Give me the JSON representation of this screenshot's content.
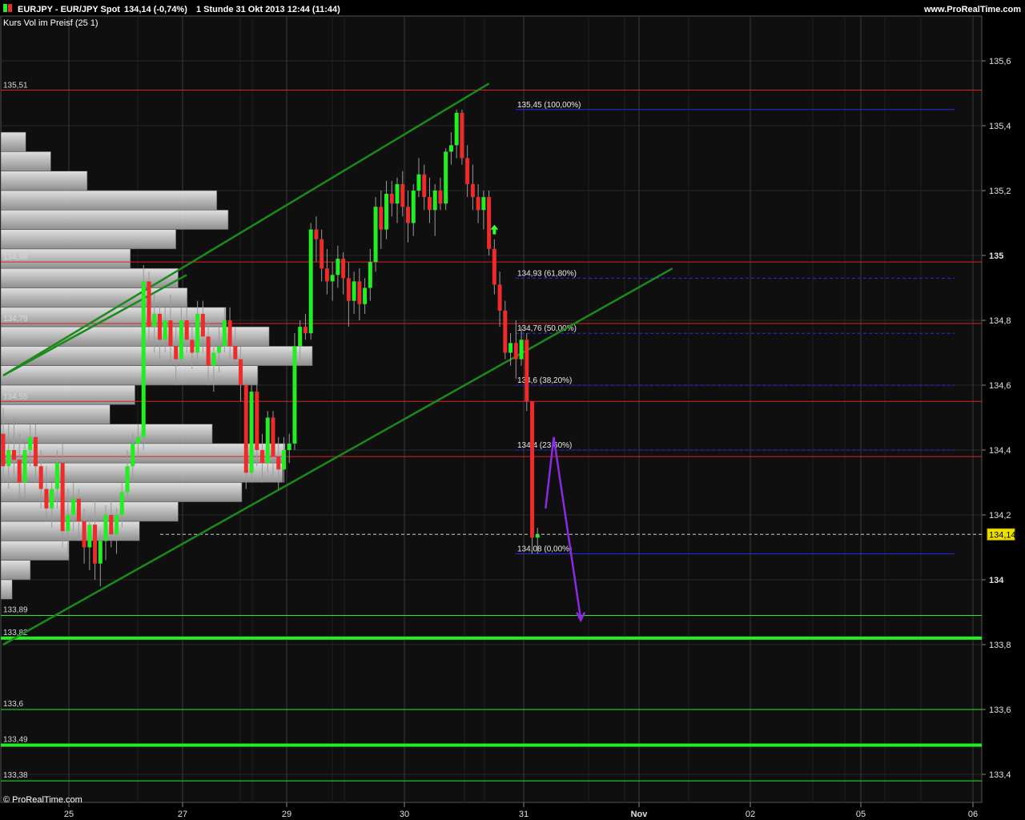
{
  "header": {
    "symbol": "EURJPY - EUR/JPY Spot",
    "quote": "134,14 (-0,74%)",
    "period": "1 Stunde  31 Okt 2013 12:44 (11:44)",
    "site": "www.ProRealTime.com",
    "subtitle": "Kurs  Vol im Preisf (25 1)",
    "watermark": "© ProRealTime.com"
  },
  "colors": {
    "background": "#000000",
    "plot": "#0f0f0f",
    "bull": "#22ee22",
    "bear": "#ee2a2a",
    "channel": "#1a8a1a",
    "support": "#22ee22",
    "resistance": "#dd2222",
    "fib": "#2a2aee",
    "projection": "#8a2be2",
    "last_price_badge": "#f0e000"
  },
  "chart_data": {
    "type": "candlestick",
    "ylim": [
      133.3,
      135.65
    ],
    "y_ticks": [
      {
        "value": 135.6,
        "label": "135,6"
      },
      {
        "value": 135.4,
        "label": "135,4"
      },
      {
        "value": 135.2,
        "label": "135,2"
      },
      {
        "value": 135.0,
        "label": "135"
      },
      {
        "value": 134.8,
        "label": "134,8"
      },
      {
        "value": 134.6,
        "label": "134,6"
      },
      {
        "value": 134.4,
        "label": "134,4"
      },
      {
        "value": 134.2,
        "label": "134,2"
      },
      {
        "value": 134.0,
        "label": "134"
      },
      {
        "value": 133.8,
        "label": "133,8"
      },
      {
        "value": 133.6,
        "label": "133,6"
      },
      {
        "value": 133.4,
        "label": "133,4"
      }
    ],
    "bold_y_ticks": [
      "135",
      "134"
    ],
    "x_ticks": [
      "25",
      "27",
      "29",
      "30",
      "31",
      "Nov",
      "02",
      "05",
      "06"
    ],
    "last_price": {
      "value": 134.14,
      "label": "134,14"
    },
    "resistance_levels": [
      {
        "value": 135.51,
        "label": "135,51"
      },
      {
        "value": 134.98,
        "label": "134,98"
      },
      {
        "value": 134.79,
        "label": "134,79"
      },
      {
        "value": 134.55,
        "label": "134,55"
      },
      {
        "value": 134.38,
        "label": "134,38"
      }
    ],
    "support_levels": [
      {
        "value": 133.89,
        "label": "133,89",
        "weight": "thin"
      },
      {
        "value": 133.82,
        "label": "133,82",
        "weight": "thick"
      },
      {
        "value": 133.6,
        "label": "133,6",
        "weight": "thin"
      },
      {
        "value": 133.49,
        "label": "133,49",
        "weight": "thick"
      },
      {
        "value": 133.38,
        "label": "133,38",
        "weight": "thin"
      }
    ],
    "fibonacci": [
      {
        "value": 135.45,
        "label": "135,45 (100,00%)",
        "style": "solid"
      },
      {
        "value": 134.93,
        "label": "134,93 (61,80%)",
        "style": "dashed"
      },
      {
        "value": 134.76,
        "label": "134,76 (50,00%)",
        "style": "dashed"
      },
      {
        "value": 134.6,
        "label": "134,6 (38,20%)",
        "style": "dashed"
      },
      {
        "value": 134.4,
        "label": "134,4 (23,60%)",
        "style": "dashed"
      },
      {
        "value": 134.08,
        "label": "134,08 (0,00%)",
        "style": "solid"
      }
    ],
    "volume_profile": [
      {
        "lo": 135.32,
        "hi": 135.38,
        "rel": 0.11
      },
      {
        "lo": 135.26,
        "hi": 135.32,
        "rel": 0.22
      },
      {
        "lo": 135.2,
        "hi": 135.26,
        "rel": 0.38
      },
      {
        "lo": 135.14,
        "hi": 135.2,
        "rel": 0.95
      },
      {
        "lo": 135.08,
        "hi": 135.14,
        "rel": 1.0
      },
      {
        "lo": 135.02,
        "hi": 135.08,
        "rel": 0.77
      },
      {
        "lo": 134.96,
        "hi": 135.02,
        "rel": 0.57
      },
      {
        "lo": 134.9,
        "hi": 134.96,
        "rel": 0.78
      },
      {
        "lo": 134.84,
        "hi": 134.9,
        "rel": 0.82
      },
      {
        "lo": 134.78,
        "hi": 134.84,
        "rel": 0.99
      },
      {
        "lo": 134.72,
        "hi": 134.78,
        "rel": 1.18
      },
      {
        "lo": 134.66,
        "hi": 134.72,
        "rel": 1.37
      },
      {
        "lo": 134.6,
        "hi": 134.66,
        "rel": 1.13
      },
      {
        "lo": 134.54,
        "hi": 134.6,
        "rel": 0.59
      },
      {
        "lo": 134.48,
        "hi": 134.54,
        "rel": 0.48
      },
      {
        "lo": 134.42,
        "hi": 134.48,
        "rel": 0.93
      },
      {
        "lo": 134.36,
        "hi": 134.42,
        "rel": 1.25
      },
      {
        "lo": 134.3,
        "hi": 134.36,
        "rel": 1.24
      },
      {
        "lo": 134.24,
        "hi": 134.3,
        "rel": 1.06
      },
      {
        "lo": 134.18,
        "hi": 134.24,
        "rel": 0.78
      },
      {
        "lo": 134.12,
        "hi": 134.18,
        "rel": 0.61
      },
      {
        "lo": 134.06,
        "hi": 134.12,
        "rel": 0.3
      },
      {
        "lo": 134.0,
        "hi": 134.06,
        "rel": 0.13
      },
      {
        "lo": 133.94,
        "hi": 134.0,
        "rel": 0.05
      }
    ],
    "candles": [
      {
        "o": 134.45,
        "h": 134.53,
        "l": 134.3,
        "c": 134.35
      },
      {
        "o": 134.35,
        "h": 134.48,
        "l": 134.28,
        "c": 134.4
      },
      {
        "o": 134.4,
        "h": 134.5,
        "l": 134.32,
        "c": 134.37
      },
      {
        "o": 134.37,
        "h": 134.45,
        "l": 134.25,
        "c": 134.3
      },
      {
        "o": 134.3,
        "h": 134.42,
        "l": 134.25,
        "c": 134.4
      },
      {
        "o": 134.4,
        "h": 134.48,
        "l": 134.35,
        "c": 134.44
      },
      {
        "o": 134.44,
        "h": 134.48,
        "l": 134.3,
        "c": 134.35
      },
      {
        "o": 134.35,
        "h": 134.4,
        "l": 134.22,
        "c": 134.28
      },
      {
        "o": 134.28,
        "h": 134.35,
        "l": 134.18,
        "c": 134.22
      },
      {
        "o": 134.22,
        "h": 134.3,
        "l": 134.16,
        "c": 134.28
      },
      {
        "o": 134.28,
        "h": 134.4,
        "l": 134.22,
        "c": 134.36
      },
      {
        "o": 134.36,
        "h": 134.42,
        "l": 134.1,
        "c": 134.15
      },
      {
        "o": 134.15,
        "h": 134.28,
        "l": 134.08,
        "c": 134.2
      },
      {
        "o": 134.2,
        "h": 134.3,
        "l": 134.15,
        "c": 134.25
      },
      {
        "o": 134.25,
        "h": 134.28,
        "l": 134.12,
        "c": 134.18
      },
      {
        "o": 134.18,
        "h": 134.22,
        "l": 134.05,
        "c": 134.1
      },
      {
        "o": 134.1,
        "h": 134.2,
        "l": 134.03,
        "c": 134.17
      },
      {
        "o": 134.17,
        "h": 134.25,
        "l": 134.0,
        "c": 134.05
      },
      {
        "o": 134.05,
        "h": 134.15,
        "l": 133.98,
        "c": 134.12
      },
      {
        "o": 134.12,
        "h": 134.23,
        "l": 134.06,
        "c": 134.2
      },
      {
        "o": 134.2,
        "h": 134.26,
        "l": 134.1,
        "c": 134.14
      },
      {
        "o": 134.14,
        "h": 134.22,
        "l": 134.08,
        "c": 134.2
      },
      {
        "o": 134.2,
        "h": 134.3,
        "l": 134.16,
        "c": 134.27
      },
      {
        "o": 134.27,
        "h": 134.4,
        "l": 134.24,
        "c": 134.35
      },
      {
        "o": 134.35,
        "h": 134.45,
        "l": 134.3,
        "c": 134.42
      },
      {
        "o": 134.42,
        "h": 134.48,
        "l": 134.36,
        "c": 134.44
      },
      {
        "o": 134.44,
        "h": 134.97,
        "l": 134.4,
        "c": 134.92
      },
      {
        "o": 134.92,
        "h": 134.95,
        "l": 134.72,
        "c": 134.78
      },
      {
        "o": 134.78,
        "h": 134.88,
        "l": 134.7,
        "c": 134.82
      },
      {
        "o": 134.82,
        "h": 134.86,
        "l": 134.68,
        "c": 134.74
      },
      {
        "o": 134.74,
        "h": 134.84,
        "l": 134.7,
        "c": 134.8
      },
      {
        "o": 134.8,
        "h": 134.88,
        "l": 134.66,
        "c": 134.72
      },
      {
        "o": 134.72,
        "h": 134.78,
        "l": 134.6,
        "c": 134.68
      },
      {
        "o": 134.68,
        "h": 134.84,
        "l": 134.66,
        "c": 134.8
      },
      {
        "o": 134.8,
        "h": 134.85,
        "l": 134.7,
        "c": 134.74
      },
      {
        "o": 134.74,
        "h": 134.8,
        "l": 134.65,
        "c": 134.7
      },
      {
        "o": 134.7,
        "h": 134.86,
        "l": 134.68,
        "c": 134.82
      },
      {
        "o": 134.82,
        "h": 134.86,
        "l": 134.7,
        "c": 134.75
      },
      {
        "o": 134.75,
        "h": 134.8,
        "l": 134.6,
        "c": 134.66
      },
      {
        "o": 134.66,
        "h": 134.74,
        "l": 134.58,
        "c": 134.7
      },
      {
        "o": 134.7,
        "h": 134.78,
        "l": 134.64,
        "c": 134.72
      },
      {
        "o": 134.72,
        "h": 134.84,
        "l": 134.7,
        "c": 134.8
      },
      {
        "o": 134.8,
        "h": 134.84,
        "l": 134.68,
        "c": 134.72
      },
      {
        "o": 134.72,
        "h": 134.78,
        "l": 134.66,
        "c": 134.68
      },
      {
        "o": 134.68,
        "h": 134.72,
        "l": 134.55,
        "c": 134.6
      },
      {
        "o": 134.6,
        "h": 134.62,
        "l": 134.28,
        "c": 134.33
      },
      {
        "o": 134.33,
        "h": 134.6,
        "l": 134.3,
        "c": 134.58
      },
      {
        "o": 134.58,
        "h": 134.6,
        "l": 134.35,
        "c": 134.4
      },
      {
        "o": 134.4,
        "h": 134.45,
        "l": 134.3,
        "c": 134.36
      },
      {
        "o": 134.36,
        "h": 134.52,
        "l": 134.33,
        "c": 134.5
      },
      {
        "o": 134.5,
        "h": 134.52,
        "l": 134.32,
        "c": 134.38
      },
      {
        "o": 134.38,
        "h": 134.44,
        "l": 134.28,
        "c": 134.34
      },
      {
        "o": 134.34,
        "h": 134.44,
        "l": 134.3,
        "c": 134.4
      },
      {
        "o": 134.4,
        "h": 134.45,
        "l": 134.36,
        "c": 134.42
      },
      {
        "o": 134.42,
        "h": 134.76,
        "l": 134.4,
        "c": 134.72
      },
      {
        "o": 134.72,
        "h": 134.8,
        "l": 134.66,
        "c": 134.78
      },
      {
        "o": 134.78,
        "h": 134.82,
        "l": 134.74,
        "c": 134.76
      },
      {
        "o": 134.76,
        "h": 135.1,
        "l": 134.74,
        "c": 135.08
      },
      {
        "o": 135.08,
        "h": 135.12,
        "l": 134.98,
        "c": 135.05
      },
      {
        "o": 135.05,
        "h": 135.08,
        "l": 134.92,
        "c": 134.96
      },
      {
        "o": 134.96,
        "h": 135.02,
        "l": 134.88,
        "c": 134.92
      },
      {
        "o": 134.92,
        "h": 134.98,
        "l": 134.86,
        "c": 134.94
      },
      {
        "o": 134.94,
        "h": 135.03,
        "l": 134.9,
        "c": 134.99
      },
      {
        "o": 134.99,
        "h": 135.01,
        "l": 134.88,
        "c": 134.93
      },
      {
        "o": 134.93,
        "h": 134.98,
        "l": 134.78,
        "c": 134.86
      },
      {
        "o": 134.86,
        "h": 134.95,
        "l": 134.82,
        "c": 134.92
      },
      {
        "o": 134.92,
        "h": 134.96,
        "l": 134.8,
        "c": 134.85
      },
      {
        "o": 134.85,
        "h": 134.93,
        "l": 134.82,
        "c": 134.9
      },
      {
        "o": 134.9,
        "h": 135.02,
        "l": 134.86,
        "c": 134.98
      },
      {
        "o": 134.98,
        "h": 135.18,
        "l": 134.95,
        "c": 135.15
      },
      {
        "o": 135.15,
        "h": 135.2,
        "l": 135.02,
        "c": 135.08
      },
      {
        "o": 135.08,
        "h": 135.23,
        "l": 135.05,
        "c": 135.19
      },
      {
        "o": 135.19,
        "h": 135.23,
        "l": 135.12,
        "c": 135.16
      },
      {
        "o": 135.16,
        "h": 135.24,
        "l": 135.1,
        "c": 135.22
      },
      {
        "o": 135.22,
        "h": 135.26,
        "l": 135.12,
        "c": 135.15
      },
      {
        "o": 135.15,
        "h": 135.2,
        "l": 135.04,
        "c": 135.1
      },
      {
        "o": 135.1,
        "h": 135.22,
        "l": 135.06,
        "c": 135.2
      },
      {
        "o": 135.2,
        "h": 135.3,
        "l": 135.18,
        "c": 135.25
      },
      {
        "o": 135.25,
        "h": 135.28,
        "l": 135.14,
        "c": 135.18
      },
      {
        "o": 135.18,
        "h": 135.24,
        "l": 135.1,
        "c": 135.14
      },
      {
        "o": 135.14,
        "h": 135.22,
        "l": 135.06,
        "c": 135.2
      },
      {
        "o": 135.2,
        "h": 135.24,
        "l": 135.14,
        "c": 135.16
      },
      {
        "o": 135.16,
        "h": 135.33,
        "l": 135.14,
        "c": 135.32
      },
      {
        "o": 135.32,
        "h": 135.38,
        "l": 135.28,
        "c": 135.34
      },
      {
        "o": 135.34,
        "h": 135.45,
        "l": 135.3,
        "c": 135.44
      },
      {
        "o": 135.44,
        "h": 135.45,
        "l": 135.28,
        "c": 135.3
      },
      {
        "o": 135.3,
        "h": 135.34,
        "l": 135.18,
        "c": 135.22
      },
      {
        "o": 135.22,
        "h": 135.28,
        "l": 135.14,
        "c": 135.18
      },
      {
        "o": 135.18,
        "h": 135.22,
        "l": 135.1,
        "c": 135.14
      },
      {
        "o": 135.14,
        "h": 135.2,
        "l": 135.08,
        "c": 135.18
      },
      {
        "o": 135.18,
        "h": 135.2,
        "l": 135.0,
        "c": 135.02
      },
      {
        "o": 135.02,
        "h": 135.05,
        "l": 134.88,
        "c": 134.91
      },
      {
        "o": 134.91,
        "h": 134.95,
        "l": 134.78,
        "c": 134.83
      },
      {
        "o": 134.83,
        "h": 134.86,
        "l": 134.68,
        "c": 134.7
      },
      {
        "o": 134.7,
        "h": 134.76,
        "l": 134.66,
        "c": 134.73
      },
      {
        "o": 134.73,
        "h": 134.8,
        "l": 134.62,
        "c": 134.68
      },
      {
        "o": 134.68,
        "h": 134.78,
        "l": 134.66,
        "c": 134.74
      },
      {
        "o": 134.74,
        "h": 134.76,
        "l": 134.52,
        "c": 134.55
      },
      {
        "o": 134.55,
        "h": 134.55,
        "l": 134.08,
        "c": 134.13
      },
      {
        "o": 134.13,
        "h": 134.16,
        "l": 134.08,
        "c": 134.14
      }
    ],
    "trendlines": [
      {
        "name": "channel-upper",
        "points": [
          [
            0,
            134.63
          ],
          [
            90,
            135.53
          ]
        ]
      },
      {
        "name": "channel-lower",
        "points": [
          [
            0,
            133.8
          ],
          [
            124,
            134.96
          ]
        ]
      },
      {
        "name": "channel-mid",
        "points": [
          [
            0,
            134.63
          ],
          [
            34,
            134.94
          ]
        ]
      }
    ],
    "projection": [
      {
        "bar": 100.5,
        "value": 134.22
      },
      {
        "bar": 102,
        "value": 134.44
      },
      {
        "bar": 107,
        "value": 133.88
      }
    ],
    "up_arrow": {
      "bar": 91,
      "value": 135.08
    }
  }
}
